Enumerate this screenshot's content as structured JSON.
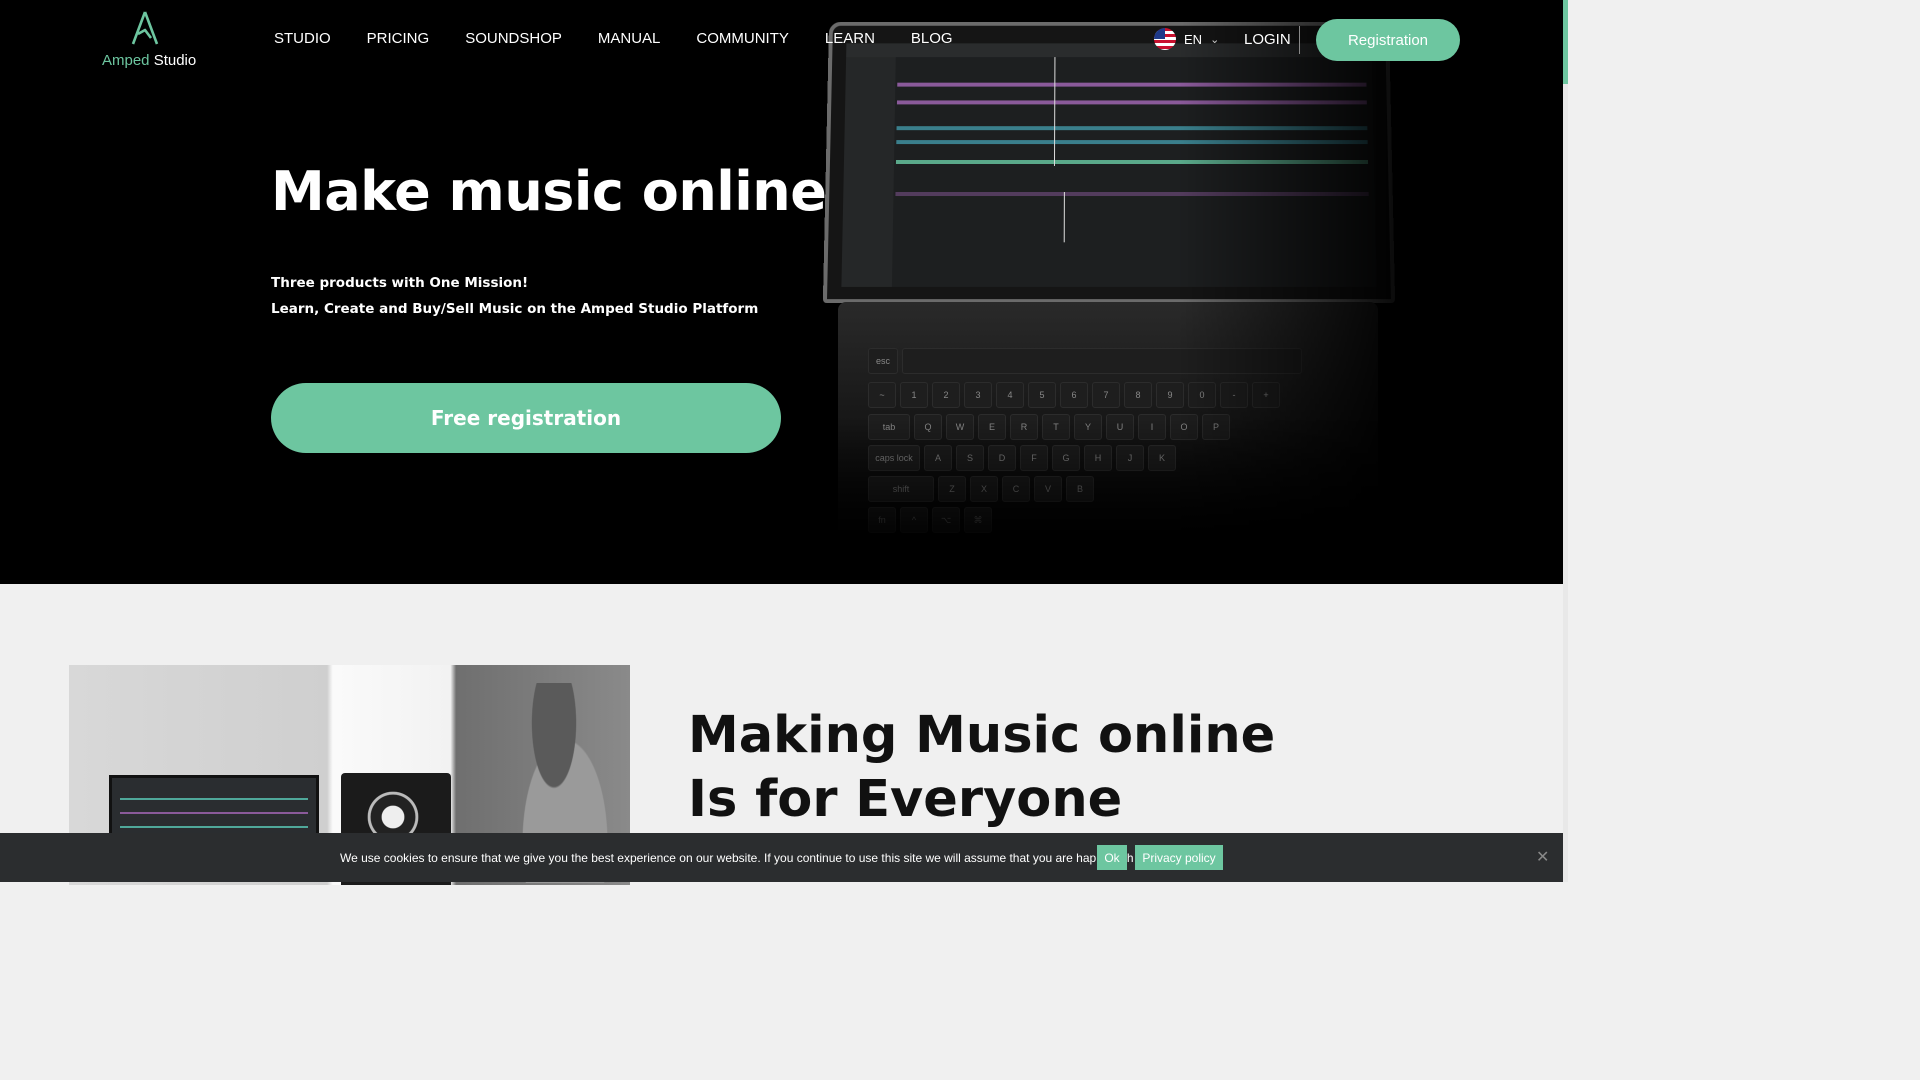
{
  "brand": {
    "name_accent": "Amped",
    "name_rest": " Studio",
    "accent_color": "#6dc6a0"
  },
  "nav": {
    "items": [
      {
        "label": "STUDIO"
      },
      {
        "label": "PRICING"
      },
      {
        "label": "SOUNDSHOP"
      },
      {
        "label": "MANUAL"
      },
      {
        "label": "COMMUNITY"
      },
      {
        "label": "LEARN"
      },
      {
        "label": "BLOG"
      }
    ]
  },
  "header": {
    "language": "EN",
    "login_label": "LOGIN",
    "register_label": "Registration"
  },
  "hero": {
    "title": "Make music online",
    "subtitle_line1": "Three products with One Mission!",
    "subtitle_line2": "Learn, Create and Buy/Sell Music on the Amped Studio Platform",
    "cta_label": "Free registration"
  },
  "section": {
    "title": "Making Music online Is for Everyone"
  },
  "cookie": {
    "message": "We use cookies to ensure that we give you the best experience on our website. If you continue to use this site we will assume that you are happy with it.",
    "ok_label": "Ok",
    "policy_label": "Privacy policy",
    "close_glyph": "✕"
  },
  "icons": {
    "flag": "us-flag-icon",
    "chevron": "chevron-down-icon",
    "close": "close-icon"
  }
}
